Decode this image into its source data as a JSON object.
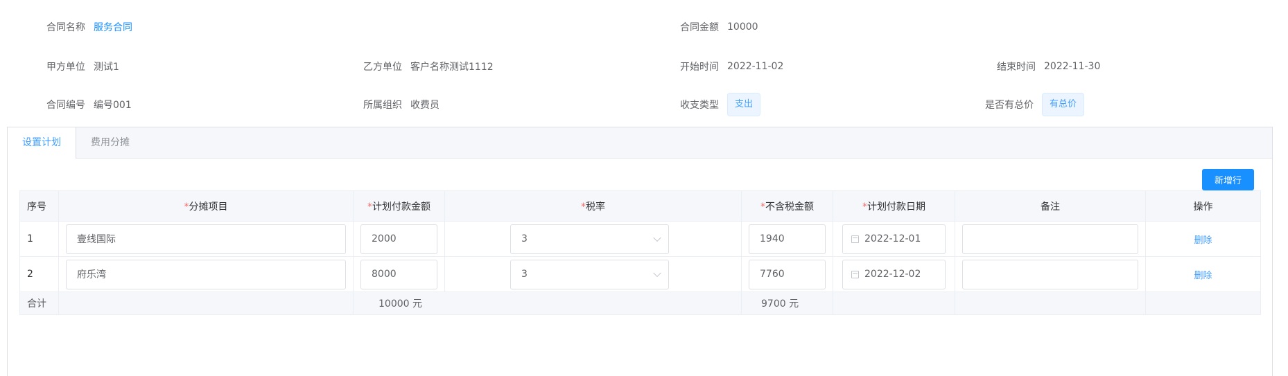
{
  "contract": {
    "name_label": "合同名称",
    "name_value": "服务合同",
    "amount_label": "合同金额",
    "amount_value": "10000",
    "party_a_label": "甲方单位",
    "party_a_value": "测试1",
    "party_b_label": "乙方单位",
    "party_b_value": "客户名称测试1112",
    "start_label": "开始时间",
    "start_value": "2022-11-02",
    "end_label": "结束时间",
    "end_value": "2022-11-30",
    "code_label": "合同编号",
    "code_value": "编号001",
    "org_label": "所属组织",
    "org_value": "收费员",
    "type_label": "收支类型",
    "type_value": "支出",
    "total_label": "是否有总价",
    "total_value": "有总价"
  },
  "tabs": [
    {
      "label": "设置计划",
      "active": true
    },
    {
      "label": "费用分摊",
      "active": false
    }
  ],
  "add_button_label": "新增行",
  "table": {
    "required_mark": "*",
    "headers": [
      "序号",
      "分摊项目",
      "计划付款金额",
      "税率",
      "不含税金额",
      "计划付款日期",
      "备注",
      "操作"
    ],
    "rows": [
      {
        "index": "1",
        "item": "壹线国际",
        "amount": "2000",
        "tax_rate": "3",
        "net_amount": "1940",
        "date": "2022-12-01",
        "remark": "",
        "action": "删除"
      },
      {
        "index": "2",
        "item": "府乐湾",
        "amount": "8000",
        "tax_rate": "3",
        "net_amount": "7760",
        "date": "2022-12-02",
        "remark": "",
        "action": "删除"
      }
    ],
    "summary": {
      "label": "合计",
      "amount_total": "10000 元",
      "net_total": "9700 元"
    }
  }
}
